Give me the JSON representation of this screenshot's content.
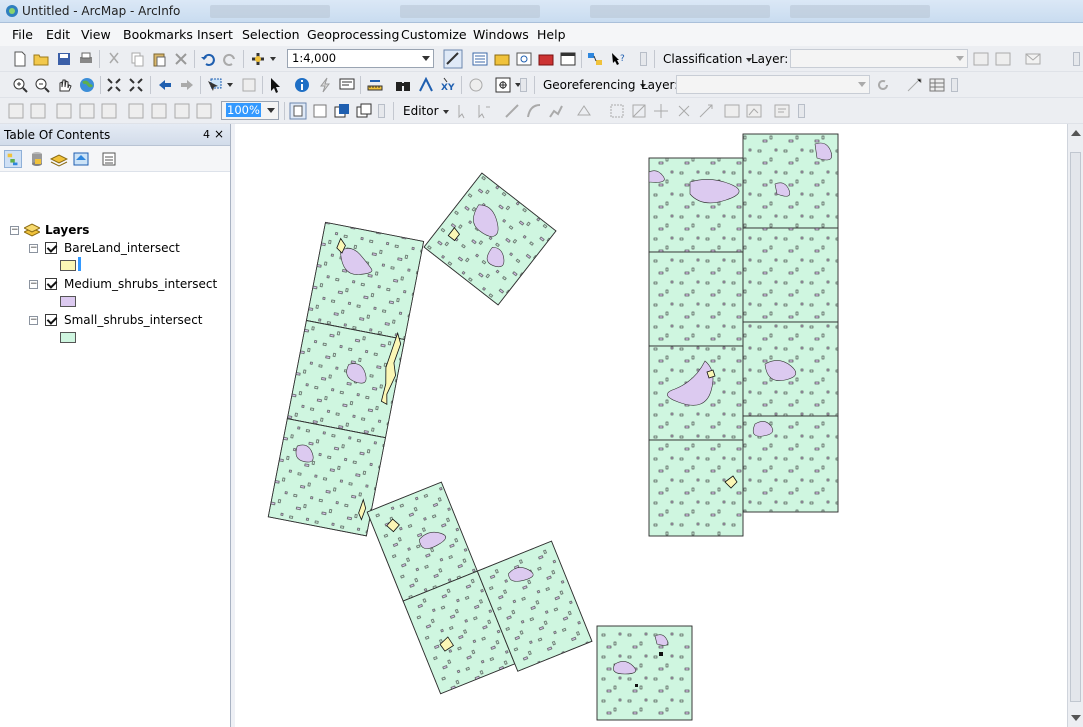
{
  "window": {
    "title": "Untitled - ArcMap - ArcInfo"
  },
  "menu": [
    "File",
    "Edit",
    "View",
    "Bookmarks",
    "Insert",
    "Selection",
    "Geoprocessing",
    "Customize",
    "Windows",
    "Help"
  ],
  "toolbar": {
    "scale_value": "1:4,000",
    "classification_label": "Classification",
    "layer_label": "Layer:",
    "georeferencing_label": "Georeferencing",
    "georef_layer_label": "Layer:",
    "transparency_value": "100%",
    "editor_label": "Editor"
  },
  "toc": {
    "title": "Table Of Contents",
    "pin_glyph": "4",
    "close_glyph": "×",
    "root": "Layers",
    "layers": [
      {
        "name": "BareLand_intersect",
        "color": "#fbf7b5",
        "checked": true
      },
      {
        "name": "Medium_shrubs_intersect",
        "color": "#dccaf0",
        "checked": true
      },
      {
        "name": "Small_shrubs_intersect",
        "color": "#cff6e0",
        "checked": true
      }
    ]
  },
  "colors": {
    "bareland": "#fbf7b5",
    "medium_shrubs": "#dccaf0",
    "small_shrubs": "#cff6e0",
    "selection": "#3399ff"
  }
}
